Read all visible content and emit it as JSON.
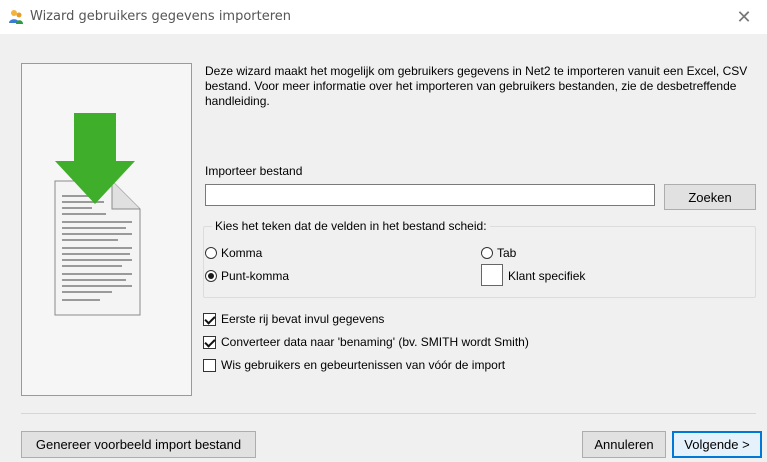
{
  "window": {
    "title": "Wizard gebruikers gegevens importeren",
    "close_symbol": "✕"
  },
  "intro_text": "Deze wizard maakt het mogelijk om gebruikers gegevens in Net2 te importeren vanuit een Excel, CSV bestand. Voor meer informatie over het importeren van gebruikers bestanden, zie de desbetreffende handleiding.",
  "import_file": {
    "label": "Importeer bestand",
    "value": "",
    "search_label": "Zoeken"
  },
  "separator_group": {
    "legend": "Kies het teken dat de velden in het bestand scheid:",
    "options": [
      {
        "label": "Komma",
        "checked": false
      },
      {
        "label": "Tab",
        "checked": false
      },
      {
        "label": "Punt-komma",
        "checked": true
      },
      {
        "label": "Klant specifiek",
        "checked": false
      }
    ]
  },
  "checkboxes": [
    {
      "label": "Eerste rij bevat invul gegevens",
      "checked": true
    },
    {
      "label": "Converteer data naar 'benaming' (bv. SMITH wordt Smith)",
      "checked": true
    },
    {
      "label": "Wis gebruikers en gebeurtenissen van vóór de import",
      "checked": false
    }
  ],
  "footer": {
    "generate_label": "Genereer voorbeeld import bestand",
    "cancel_label": "Annuleren",
    "next_label": "Volgende >"
  },
  "colors": {
    "arrow_green": "#3fae2a",
    "accent_blue": "#0078d7"
  }
}
